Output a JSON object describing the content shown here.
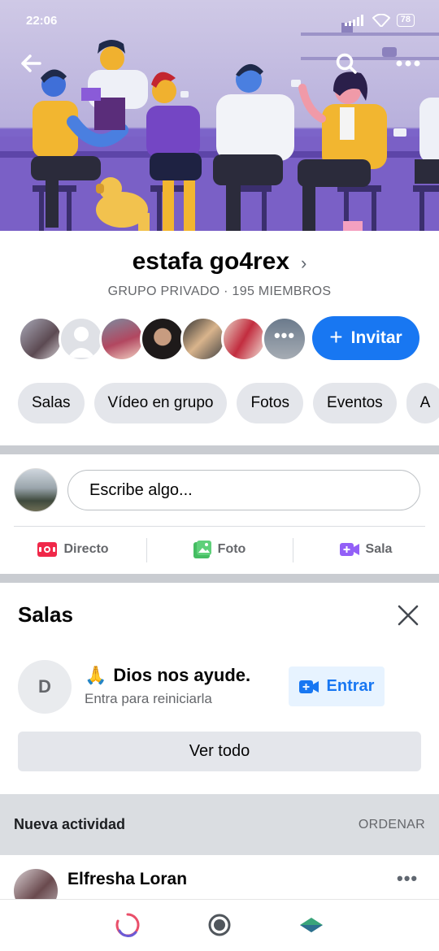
{
  "status_bar": {
    "time": "22:06",
    "battery": "78"
  },
  "cover": {
    "back_icon": "arrow-left-icon",
    "search_icon": "search-icon",
    "more_icon": "more-horizontal-icon"
  },
  "group": {
    "name": "estafa go4rex",
    "meta": "GRUPO PRIVADO · 195 MIEMBROS",
    "invite_label": "Invitar"
  },
  "tabs": [
    {
      "label": "Salas"
    },
    {
      "label": "Vídeo en grupo"
    },
    {
      "label": "Fotos"
    },
    {
      "label": "Eventos"
    },
    {
      "label": "A"
    }
  ],
  "composer": {
    "placeholder": "Escribe algo...",
    "actions": [
      {
        "label": "Directo",
        "icon": "live-video-icon",
        "color": "#f02849"
      },
      {
        "label": "Foto",
        "icon": "photo-icon",
        "color": "#45bd62"
      },
      {
        "label": "Sala",
        "icon": "room-video-icon",
        "color": "#9360f7"
      }
    ]
  },
  "rooms": {
    "title": "Salas",
    "room": {
      "initial": "D",
      "emoji": "🙏",
      "name": "Dios nos ayude.",
      "subtitle": "Entra para reiniciarla",
      "enter_label": "Entrar"
    },
    "see_all_label": "Ver todo"
  },
  "activity": {
    "title": "Nueva actividad",
    "sort_label": "ORDENAR"
  },
  "post": {
    "author": "Elfresha Loran"
  },
  "colors": {
    "primary": "#1877f2",
    "chip_bg": "#e4e6eb",
    "secondary_text": "#65676b"
  }
}
